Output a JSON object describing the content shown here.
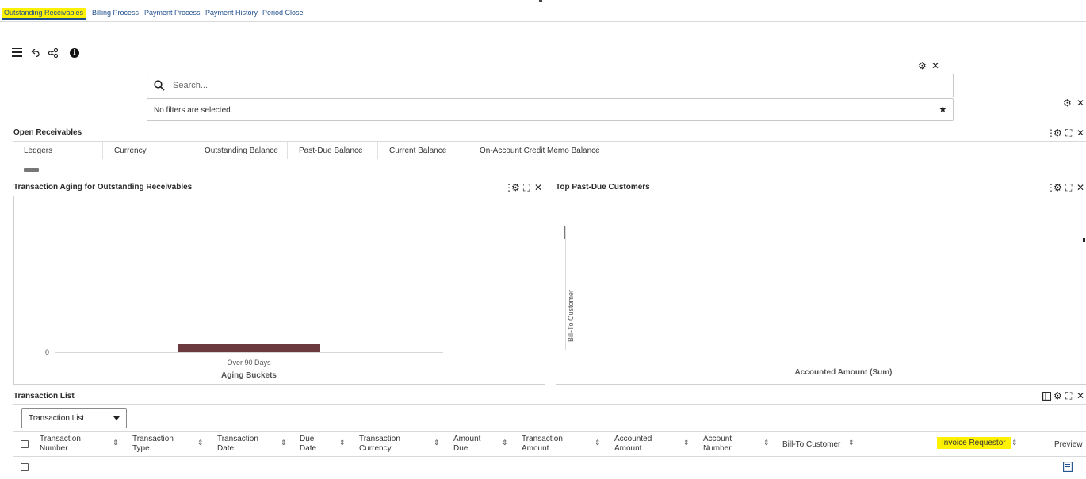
{
  "tabs": [
    {
      "label": "Outstanding Receivables",
      "active": true
    },
    {
      "label": "Billing Process"
    },
    {
      "label": "Payment Process"
    },
    {
      "label": "Payment History"
    },
    {
      "label": "Period Close"
    }
  ],
  "search": {
    "placeholder": "Search..."
  },
  "filters": {
    "status": "No filters are selected."
  },
  "open_receivables": {
    "title": "Open Receivables",
    "columns": [
      "Ledgers",
      "Currency",
      "Outstanding Balance",
      "Past-Due Balance",
      "Current Balance",
      "On-Account Credit Memo Balance"
    ]
  },
  "aging_chart": {
    "title": "Transaction Aging for Outstanding Receivables",
    "zero_label": "0",
    "bar_color": "#6b3a3f"
  },
  "top_customers": {
    "title": "Top Past-Due Customers",
    "ylabel": "Bill-To Customer",
    "xlabel": "Accounted Amount (Sum)"
  },
  "chart_data": [
    {
      "type": "bar",
      "title": "Transaction Aging for Outstanding Receivables",
      "categories": [
        "Over 90 Days"
      ],
      "xlabel": "Aging Buckets",
      "ylabel": "",
      "y_tick_labels": [
        "0"
      ]
    }
  ],
  "transaction_list": {
    "title": "Transaction List",
    "dropdown_value": "Transaction List",
    "columns": [
      [
        "Transaction",
        "Number"
      ],
      [
        "Transaction",
        "Type"
      ],
      [
        "Transaction",
        "Date"
      ],
      [
        "Due",
        "Date"
      ],
      [
        "Transaction",
        "Currency"
      ],
      [
        "Amount",
        "Due"
      ],
      [
        "Transaction",
        "Amount"
      ],
      [
        "Accounted",
        "Amount"
      ],
      [
        "Account",
        "Number"
      ],
      [
        "Bill-To Customer"
      ],
      [
        "Invoice Requestor"
      ],
      [
        "Preview"
      ]
    ]
  },
  "colors": {
    "link": "#1f4e8c",
    "highlight": "#fff200"
  }
}
